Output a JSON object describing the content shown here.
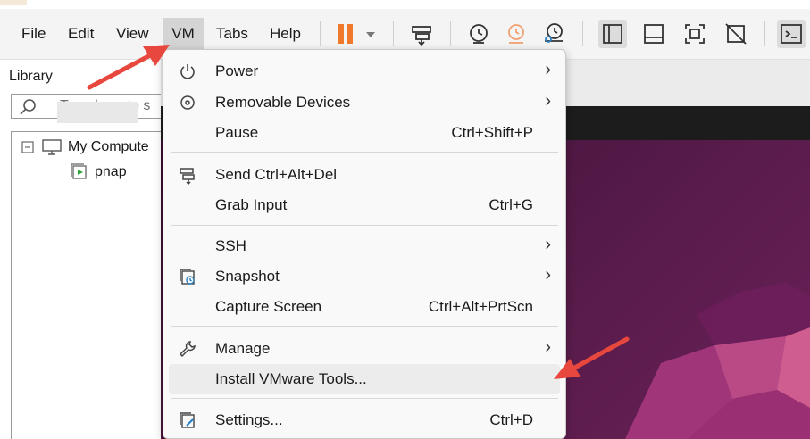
{
  "menubar": {
    "items": [
      {
        "label": "File"
      },
      {
        "label": "Edit"
      },
      {
        "label": "View"
      },
      {
        "label": "VM",
        "active": true
      },
      {
        "label": "Tabs"
      },
      {
        "label": "Help"
      }
    ],
    "toolbar_icons": [
      "pause-icon",
      "dropdown-caret-icon",
      "send-ctrl-alt-del-icon",
      "snapshot-take-icon",
      "snapshot-revert-icon",
      "snapshot-manager-icon",
      "library-view-icon",
      "thumbnail-bar-icon",
      "full-screen-icon",
      "unity-icon",
      "console-view-icon"
    ]
  },
  "library": {
    "title": "Library",
    "search_placeholder": "Type here to s",
    "tree": {
      "root_label": "My Compute",
      "child_label": "pnap"
    }
  },
  "vm_menu": {
    "items": [
      {
        "label": "Power",
        "shortcut": "",
        "submenu": true,
        "icon": "power-icon"
      },
      {
        "label": "Removable Devices",
        "shortcut": "",
        "submenu": true,
        "icon": "removable-devices-icon"
      },
      {
        "label": "Pause",
        "shortcut": "Ctrl+Shift+P",
        "submenu": false,
        "icon": ""
      },
      {
        "label": "Send Ctrl+Alt+Del",
        "shortcut": "",
        "submenu": false,
        "icon": "send-ctrl-alt-del-icon"
      },
      {
        "label": "Grab Input",
        "shortcut": "Ctrl+G",
        "submenu": false,
        "icon": ""
      },
      {
        "label": "SSH",
        "shortcut": "",
        "submenu": true,
        "icon": ""
      },
      {
        "label": "Snapshot",
        "shortcut": "",
        "submenu": true,
        "icon": "snapshot-icon"
      },
      {
        "label": "Capture Screen",
        "shortcut": "Ctrl+Alt+PrtScn",
        "submenu": false,
        "icon": ""
      },
      {
        "label": "Manage",
        "shortcut": "",
        "submenu": true,
        "icon": "wrench-icon"
      },
      {
        "label": "Install VMware Tools...",
        "shortcut": "",
        "submenu": false,
        "icon": "",
        "highlighted": true
      },
      {
        "label": "Settings...",
        "shortcut": "Ctrl+D",
        "submenu": false,
        "icon": "settings-icon"
      }
    ],
    "submenu_glyph": "›"
  },
  "colors": {
    "annotation_arrow": "#e8473d",
    "pause_accent": "#f0792b",
    "desktop_purple": "#4b1640",
    "menubar_bg": "#f4f4f4"
  }
}
